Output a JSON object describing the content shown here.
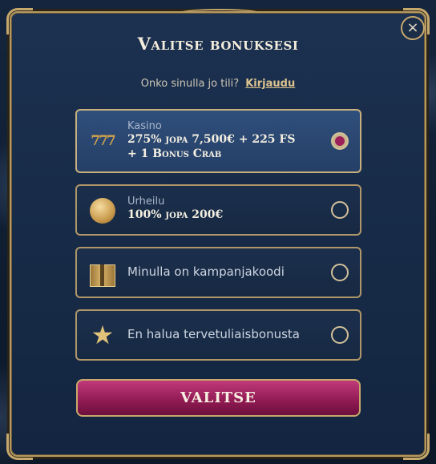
{
  "modal": {
    "title": "Valitse bonuksesi",
    "close_label": "×"
  },
  "login": {
    "prompt": "Onko sinulla jo tili?",
    "link": "Kirjaudu"
  },
  "options": [
    {
      "category": "Kasino",
      "line1": "275% jopa 7,500€ + 225 FS",
      "line2": "+ 1 Bonus Crab",
      "icon": "slot-777-icon",
      "icon_text": "777",
      "selected": true
    },
    {
      "category": "Urheilu",
      "line1": "100% jopa 200€",
      "icon": "football-icon",
      "selected": false
    },
    {
      "label": "Minulla on kampanjakoodi",
      "icon": "gift-box-icon",
      "selected": false
    },
    {
      "label": "En halua tervetuliaisbonusta",
      "icon": "star-icon",
      "icon_text": "★",
      "selected": false
    }
  ],
  "submit_label": "VALITSE",
  "colors": {
    "accent_gold": "#c7a86c",
    "button_magenta": "#a82a68",
    "panel_navy": "#1b2f4d"
  }
}
